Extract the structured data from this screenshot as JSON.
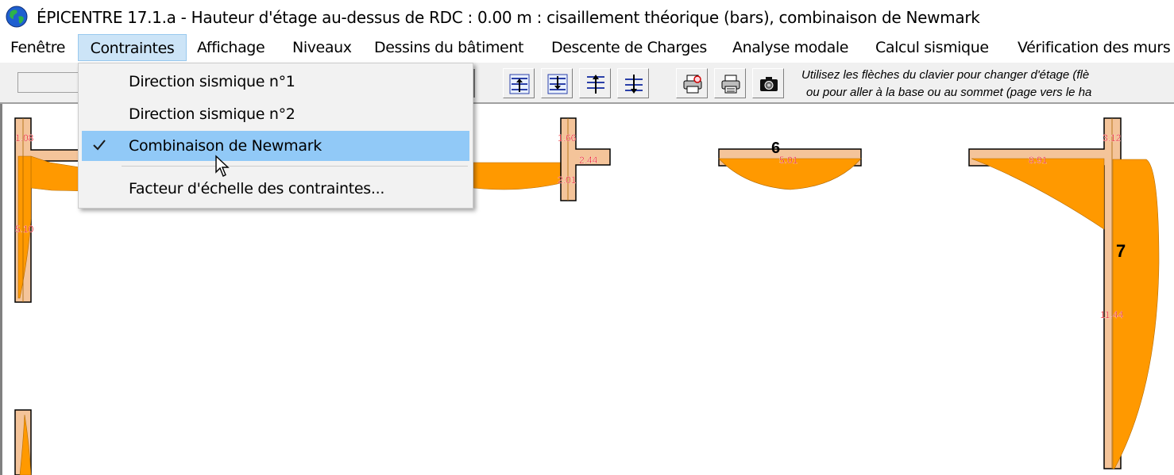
{
  "window": {
    "title": "ÉPICENTRE 17.1.a - Hauteur d'étage au-dessus de RDC : 0.00 m : cisaillement théorique (bars), combinaison de Newmark",
    "icon": "globe-icon"
  },
  "menubar": {
    "items": [
      {
        "label": "Fenêtre"
      },
      {
        "label": "Contraintes"
      },
      {
        "label": "Affichage"
      },
      {
        "label": "Niveaux"
      },
      {
        "label": "Dessins du bâtiment"
      },
      {
        "label": "Descente de Charges"
      },
      {
        "label": "Analyse modale"
      },
      {
        "label": "Calcul sismique"
      },
      {
        "label": "Vérification des murs"
      }
    ]
  },
  "dropdown": {
    "items": [
      {
        "label": "Direction sismique n°1",
        "checked": false
      },
      {
        "label": "Direction sismique n°2",
        "checked": false
      },
      {
        "label": "Combinaison de Newmark",
        "checked": true
      },
      {
        "label": "Facteur d'échelle des contraintes..."
      }
    ]
  },
  "toolbar": {
    "icons": [
      "level-up-icon",
      "level-down-icon",
      "go-top-icon",
      "go-bottom-icon",
      "print-preview-icon",
      "print-icon",
      "camera-icon"
    ],
    "hint_line1": "Utilisez les flèches du clavier pour changer d'étage (flè",
    "hint_line2": "ou pour aller à la base ou au sommet (page vers le ha"
  },
  "drawing": {
    "values": [
      "1.08",
      "5.10",
      "1.66",
      "2.44",
      "2.01",
      "5.01",
      "8.91",
      "3.12",
      "11.44"
    ],
    "wall_labels": [
      "6",
      "7"
    ],
    "colors": {
      "wall": "#f4c49a",
      "stress": "#ff9900",
      "value_text": "#e8000a",
      "wall_outline": "#000000"
    }
  }
}
